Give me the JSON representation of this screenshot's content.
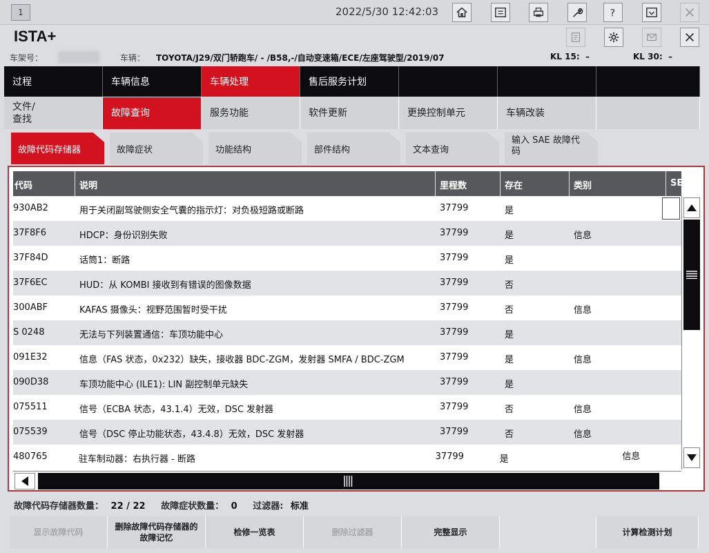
{
  "system": {
    "window_number": "1",
    "datetime": "2022/5/30 12:42:03"
  },
  "app": {
    "title": "ISTA+"
  },
  "vehicle_info": {
    "vin_label": "车架号：",
    "vehicle_label": "车辆：",
    "vehicle_value": "TOYOTA/J29/双门轿跑车/ - /B58,-/自动变速箱/ECE/左座驾驶型/2019/07",
    "kl15_label": "KL 15:",
    "kl15_value": "–",
    "kl30_label": "KL 30:",
    "kl30_value": "–"
  },
  "nav_main": [
    {
      "label": "过程"
    },
    {
      "label": "车辆信息"
    },
    {
      "label": "车辆处理"
    },
    {
      "label": "售后服务计划"
    },
    {
      "label": ""
    },
    {
      "label": ""
    },
    {
      "label": ""
    }
  ],
  "nav_sub": [
    {
      "label": "文件/ 查找"
    },
    {
      "label": "故障查询"
    },
    {
      "label": "服务功能"
    },
    {
      "label": "软件更新"
    },
    {
      "label": "更换控制单元"
    },
    {
      "label": "车辆改装"
    },
    {
      "label": ""
    }
  ],
  "tabs": [
    {
      "label": "故障代码存储器"
    },
    {
      "label": "故障症状"
    },
    {
      "label": "功能结构"
    },
    {
      "label": "部件结构"
    },
    {
      "label": "文本查询"
    },
    {
      "label": "输入 SAE 故障代码"
    }
  ],
  "table": {
    "columns": [
      "代码",
      "说明",
      "里程数",
      "存在",
      "类别",
      "SE"
    ],
    "rows": [
      {
        "code": "930AB2",
        "desc": "用于关闭副驾驶侧安全气囊的指示灯：对负极短路或断路",
        "mileage": "37799",
        "present": "是",
        "category": "",
        "extra": ""
      },
      {
        "code": "37F8F6",
        "desc": "HDCP：身份识别失败",
        "mileage": "37799",
        "present": "是",
        "category": "信息",
        "extra": ""
      },
      {
        "code": "37F84D",
        "desc": "话筒1：断路",
        "mileage": "37799",
        "present": "是",
        "category": "",
        "extra": ""
      },
      {
        "code": "37F6EC",
        "desc": "HUD：从 KOMBI 接收到有错误的图像数据",
        "mileage": "37799",
        "present": "否",
        "category": "",
        "extra": ""
      },
      {
        "code": "300ABF",
        "desc": "KAFAS 摄像头：视野范围暂时受干扰",
        "mileage": "37799",
        "present": "否",
        "category": "信息",
        "extra": ""
      },
      {
        "code": "S 0248",
        "desc": "无法与下列装置通信：车顶功能中心",
        "mileage": "37799",
        "present": "是",
        "category": "",
        "extra": ""
      },
      {
        "code": "091E32",
        "desc": "信息（FAS 状态，0x232）缺失，接收器 BDC-ZGM，发射器 SMFA / BDC-ZGM",
        "mileage": "37799",
        "present": "是",
        "category": "信息",
        "extra": ""
      },
      {
        "code": "090D38",
        "desc": "车顶功能中心 (ILE1): LIN 副控制单元缺失",
        "mileage": "37799",
        "present": "是",
        "category": "",
        "extra": ""
      },
      {
        "code": "075511",
        "desc": "信号（ECBA 状态，43.1.4）无效，DSC 发射器",
        "mileage": "37799",
        "present": "否",
        "category": "信息",
        "extra": ""
      },
      {
        "code": "075539",
        "desc": "信号（DSC 停止功能状态，43.4.8）无效，DSC 发射器",
        "mileage": "37799",
        "present": "否",
        "category": "信息",
        "extra": ""
      },
      {
        "code": "480765",
        "desc": "驻车制动器：右执行器 - 断路",
        "mileage": "37799",
        "present": "是",
        "category": "",
        "extra": "信息"
      }
    ]
  },
  "status": {
    "fault_count_label": "故障代码存储器数量：",
    "fault_count_value": "22 / 22",
    "symptom_count_label": "故障症状数量：",
    "symptom_count_value": "0",
    "filter_label": "过滤器:",
    "filter_value": "标准"
  },
  "buttons": [
    {
      "label": "显示故障代码",
      "enabled": false
    },
    {
      "label": "删除故障代码存储器的故障记忆",
      "enabled": true
    },
    {
      "label": "检修一览表",
      "enabled": true
    },
    {
      "label": "删除过滤器",
      "enabled": false
    },
    {
      "label": "完整显示",
      "enabled": true
    },
    {
      "label": "",
      "enabled": false
    },
    {
      "label": "计算检测计划",
      "enabled": true
    }
  ],
  "colors": {
    "accent_red": "#d3121f",
    "nav_black": "#0c0c0e",
    "header_gray": "#56585c",
    "row_alt": "#e2e3e6",
    "frame_border": "#b0323a"
  },
  "icons": {
    "toolbar": [
      "home-icon",
      "screen-switch-icon",
      "printer-icon",
      "wrench-icon",
      "help-icon",
      "minimize-window-icon",
      "close-icon"
    ],
    "title": [
      "notes-icon",
      "gear-icon",
      "mail-icon",
      "close-icon"
    ]
  }
}
